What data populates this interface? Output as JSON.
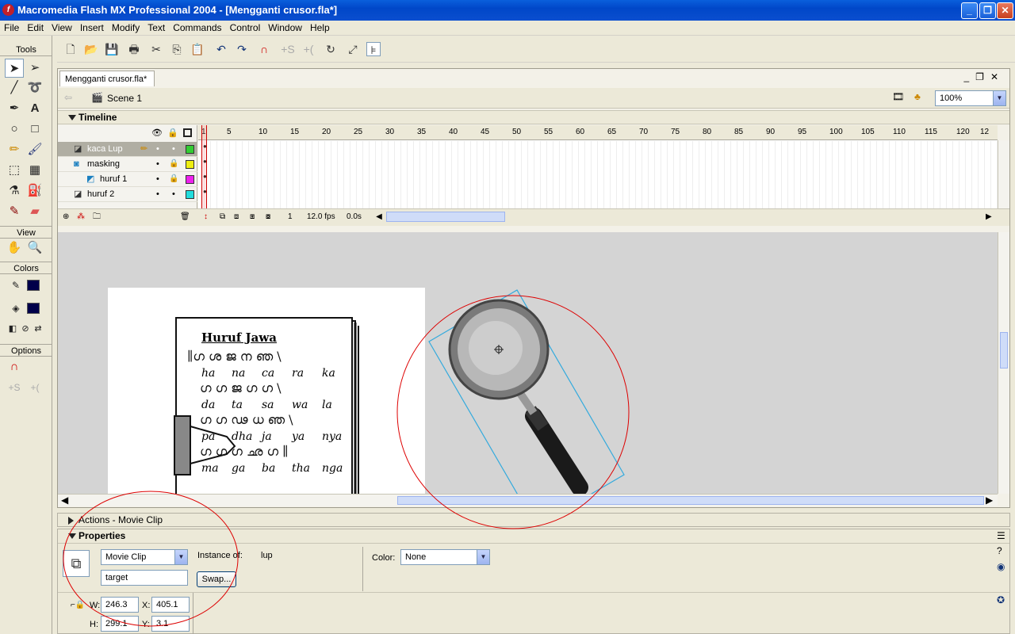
{
  "window": {
    "title": "Macromedia Flash MX Professional 2004 - [Mengganti crusor.fla*]",
    "app_icon": "flash-logo-icon",
    "controls": [
      "minimize",
      "maximize",
      "close"
    ]
  },
  "menu": [
    "File",
    "Edit",
    "View",
    "Insert",
    "Modify",
    "Text",
    "Commands",
    "Control",
    "Window",
    "Help"
  ],
  "tools": {
    "header": "Tools",
    "view_header": "View",
    "colors_header": "Colors",
    "options_header": "Options",
    "stroke_color": "#00004a",
    "fill_color": "#00004a"
  },
  "document": {
    "tab_label": "Mengganti crusor.fla*",
    "scene_label": "Scene 1",
    "zoom": "100%"
  },
  "timeline": {
    "header": "Timeline",
    "frame_numbers": [
      "1",
      "5",
      "10",
      "15",
      "20",
      "25",
      "30",
      "35",
      "40",
      "45",
      "50",
      "55",
      "60",
      "65",
      "70",
      "75",
      "80",
      "85",
      "90",
      "95",
      "100",
      "105",
      "110",
      "115",
      "120",
      "12"
    ],
    "layers": [
      {
        "name": "kaca Lup",
        "color": "#33cc33",
        "selected": true
      },
      {
        "name": "masking",
        "color": "#eeee11",
        "selected": false
      },
      {
        "name": "huruf 1",
        "color": "#ee22ee",
        "selected": false
      },
      {
        "name": "huruf 2",
        "color": "#22dddd",
        "selected": false
      }
    ],
    "current_frame": "1",
    "fps": "12.0 fps",
    "elapsed": "0.0s"
  },
  "stage": {
    "book_title": "Huruf Jawa",
    "latin_rows": [
      [
        "ha",
        "na",
        "ca",
        "ra",
        "ka"
      ],
      [
        "da",
        "ta",
        "sa",
        "wa",
        "la"
      ],
      [
        "pa",
        "dha",
        "ja",
        "ya",
        "nya"
      ],
      [
        "ma",
        "ga",
        "ba",
        "tha",
        "nga"
      ]
    ],
    "selection_color": "#33aadd",
    "annotation_color": "#dd0000"
  },
  "actions_panel": {
    "label": "Actions - Movie Clip"
  },
  "properties": {
    "header": "Properties",
    "symbol_type": "Movie Clip",
    "instance_name": "target",
    "instance_of_label": "Instance of:",
    "instance_of_value": "lup",
    "swap_label": "Swap...",
    "color_label": "Color:",
    "color_value": "None",
    "w_label": "W:",
    "w_value": "246.3",
    "h_label": "H:",
    "h_value": "299.1",
    "x_label": "X:",
    "x_value": "405.1",
    "y_label": "Y:",
    "y_value": "3.1"
  }
}
